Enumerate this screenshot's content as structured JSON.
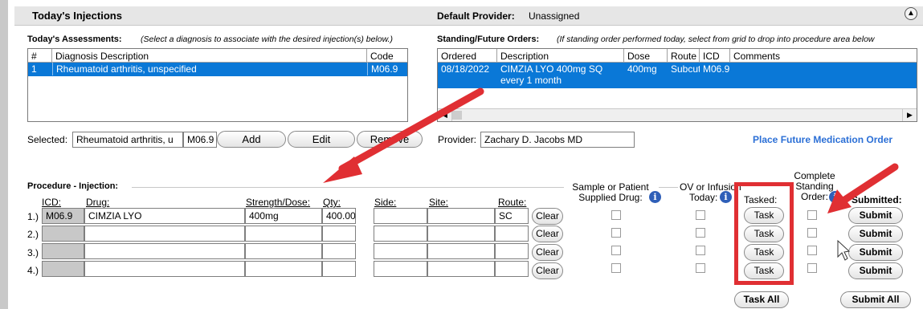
{
  "header": {
    "title": "Today's Injections",
    "default_provider_label": "Default Provider:",
    "default_provider_value": "Unassigned"
  },
  "assessments": {
    "label": "Today's Assessments:",
    "hint": "(Select a diagnosis to associate with the desired injection(s) below.)",
    "columns": [
      "#",
      "Diagnosis Description",
      "Code"
    ],
    "rows": [
      {
        "num": "1",
        "description": "Rheumatoid arthritis, unspecified",
        "code": "M06.9"
      }
    ]
  },
  "orders": {
    "label": "Standing/Future Orders:",
    "hint": "(If standing order performed today, select from grid to drop into procedure area below",
    "columns": [
      "Ordered",
      "Description",
      "Dose",
      "Route",
      "ICD",
      "Comments"
    ],
    "rows": [
      {
        "ordered": "08/18/2022",
        "description_line1": "CIMZIA LYO 400mg SQ",
        "description_line2": "every 1 month",
        "dose": "400mg",
        "route": "Subcut",
        "icd": "M06.9",
        "comments": ""
      }
    ]
  },
  "selected": {
    "label": "Selected:",
    "diagnosis": "Rheumatoid arthritis, u",
    "code": "M06.9"
  },
  "buttons": {
    "add": "Add",
    "edit": "Edit",
    "remove": "Remove",
    "task_all": "Task All",
    "submit_all": "Submit All"
  },
  "provider": {
    "label": "Provider:",
    "value": "Zachary D. Jacobs MD"
  },
  "place_future_order": "Place Future Medication Order",
  "procedure": {
    "label": "Procedure - Injection:",
    "headers": {
      "icd": "ICD:",
      "drug": "Drug:",
      "strength": "Strength/Dose:",
      "qty": "Qty:",
      "side": "Side:",
      "site": "Site:",
      "route": "Route:",
      "sample_line1": "Sample or Patient",
      "sample_line2": "Supplied Drug:",
      "ov_line1": "OV or Infusion",
      "ov_line2": "Today:",
      "tasked": "Tasked:",
      "complete_line1": "Complete",
      "complete_line2": "Standing",
      "complete_line3": "Order:",
      "submitted": "Submitted:"
    },
    "rows": [
      {
        "num": "1.)",
        "icd": "M06.9",
        "drug": "CIMZIA LYO",
        "strength": "400mg",
        "qty": "400.00",
        "side": "",
        "site": "",
        "route": "SC",
        "clear": "Clear",
        "task": "Task",
        "submit": "Submit"
      },
      {
        "num": "2.)",
        "icd": "",
        "drug": "",
        "strength": "",
        "qty": "",
        "side": "",
        "site": "",
        "route": "",
        "clear": "Clear",
        "task": "Task",
        "submit": "Submit"
      },
      {
        "num": "3.)",
        "icd": "",
        "drug": "",
        "strength": "",
        "qty": "",
        "side": "",
        "site": "",
        "route": "",
        "clear": "Clear",
        "task": "Task",
        "submit": "Submit"
      },
      {
        "num": "4.)",
        "icd": "",
        "drug": "",
        "strength": "",
        "qty": "",
        "side": "",
        "site": "",
        "route": "",
        "clear": "Clear",
        "task": "Task",
        "submit": "Submit"
      }
    ]
  },
  "colors": {
    "selection": "#0a78d7",
    "link": "#2b6fd6",
    "annotation_red": "#e02f33"
  },
  "icons": {
    "collapse": "chevron-up-icon",
    "info": "info-icon"
  }
}
